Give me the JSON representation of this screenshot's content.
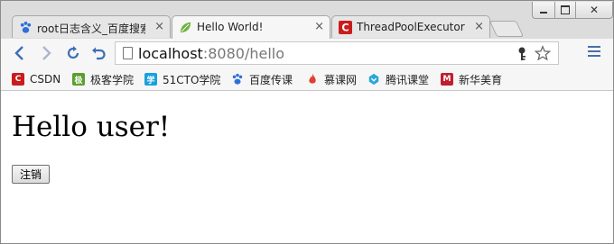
{
  "tabs": [
    {
      "label": "root日志含义_百度搜索",
      "icon": "baidu-paw-icon",
      "active": false
    },
    {
      "label": "Hello World!",
      "icon": "spring-leaf-icon",
      "active": true
    },
    {
      "label": "ThreadPoolExecutor",
      "icon": "csdn-icon",
      "active": false
    }
  ],
  "tab_close_glyph": "×",
  "address_bar": {
    "host": "localhost",
    "rest": ":8080/hello"
  },
  "bookmarks": [
    {
      "label": "CSDN",
      "icon": "csdn-icon",
      "color": "#c91c1c",
      "glyph": "C"
    },
    {
      "label": "极客学院",
      "icon": "jikexueyuan-icon",
      "color": "#5a9e2f",
      "glyph": "极"
    },
    {
      "label": "51CTO学院",
      "icon": "51cto-icon",
      "color": "#1aa0dc",
      "glyph": "学"
    },
    {
      "label": "百度传课",
      "icon": "baidu-paw-icon",
      "color": "#2f6fdb",
      "glyph": ""
    },
    {
      "label": "慕课网",
      "icon": "imooc-flame-icon",
      "color": "#e04030",
      "glyph": ""
    },
    {
      "label": "腾讯课堂",
      "icon": "tencent-ketang-icon",
      "color": "#2aa7d8",
      "glyph": ""
    },
    {
      "label": "新华美育",
      "icon": "xinhua-meiyu-icon",
      "color": "#c01f2f",
      "glyph": "M"
    }
  ],
  "page": {
    "heading": "Hello user!",
    "logout_button": "注销"
  },
  "colors": {
    "nav_icon": "#3d6fb6",
    "spring_green": "#6db33f"
  }
}
